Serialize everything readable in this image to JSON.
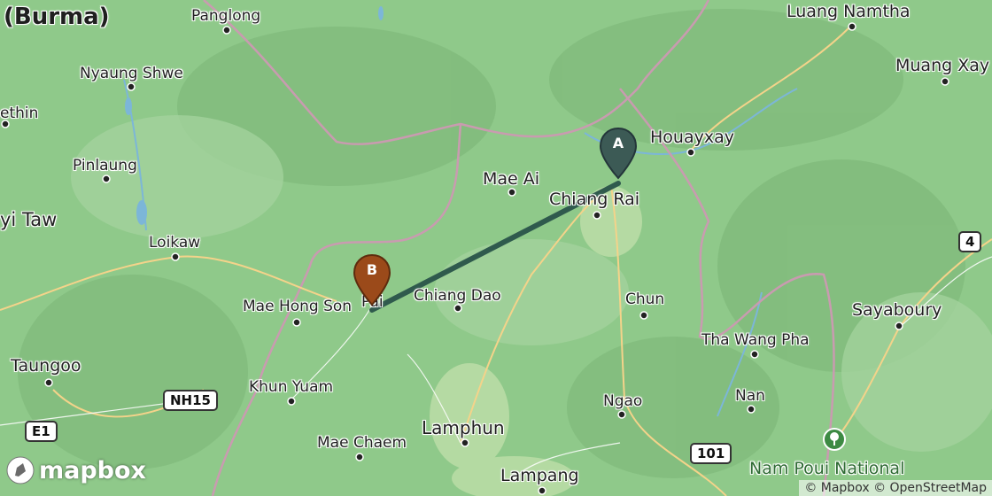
{
  "map": {
    "logo_text": "mapbox",
    "attribution": "© Mapbox © OpenStreetMap",
    "park_icon": "tree-icon",
    "route_color": "#2f5a4d",
    "marker_a": {
      "label": "A",
      "color": "#3c5a55"
    },
    "marker_b": {
      "label": "B",
      "color": "#9b4a1a"
    },
    "places": {
      "burma": "(Burma)",
      "panglong": "Panglong",
      "luang_namtha": "Luang Namtha",
      "muang_xay": "Muang Xay",
      "nyaung_shwe": "Nyaung Shwe",
      "thethin": "ethin",
      "houayxay": "Houayxay",
      "mae_ai": "Mae Ai",
      "chiang_rai": "Chiang Rai",
      "pinlaung": "Pinlaung",
      "pyi_taw": "yi Taw",
      "loikaw": "Loikaw",
      "mae_hong_son": "Mae Hong Son",
      "pai": "Pai",
      "chiang_dao": "Chiang Dao",
      "chun": "Chun",
      "sayaboury": "Sayaboury",
      "tha_wang_pha": "Tha Wang Pha",
      "taungoo": "Taungoo",
      "khun_yuam": "Khun Yuam",
      "nan": "Nan",
      "ngao": "Ngao",
      "lamphun": "Lamphun",
      "mae_chaem": "Mae Chaem",
      "lampang": "Lampang",
      "nam_poui": "Nam Poui National"
    },
    "roads": {
      "nh15": "NH15",
      "e1": "E1",
      "r4": "4",
      "r101": "101"
    }
  }
}
